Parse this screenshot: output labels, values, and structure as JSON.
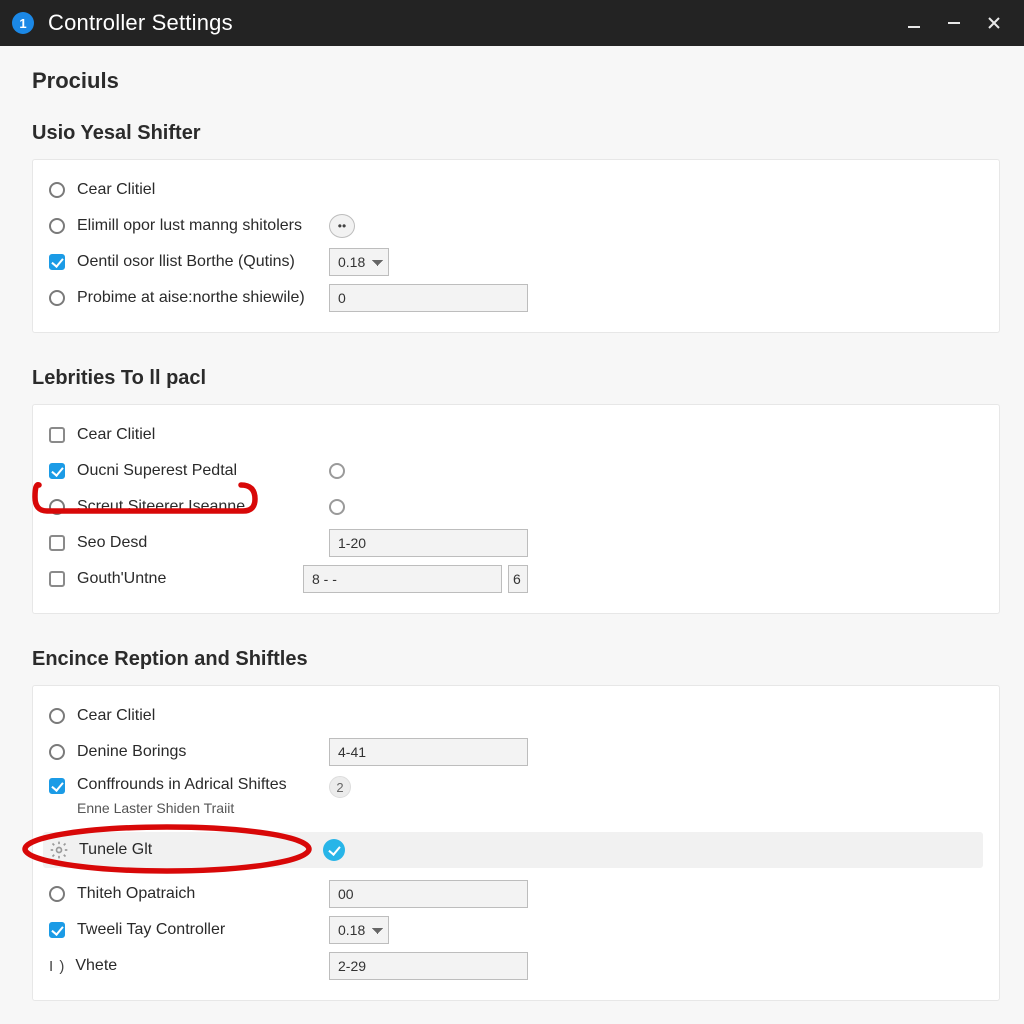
{
  "titlebar": {
    "badge": "1",
    "title": "Controller Settings"
  },
  "page_heading": "Prociuls",
  "sections": {
    "s1": {
      "heading": "Usio Yesal Shifter",
      "r0_label": "Cear Clitiel",
      "r1_label": "Elimill opor lust manng shitolers",
      "r2_label": "Oentil osor llist Borthe (Qutins)",
      "r2_value": "0.18",
      "r3_label": "Probime at aise:northe shiewile)",
      "r3_value": "0"
    },
    "s2": {
      "heading": "Lebrities To ll pacl",
      "r0_label": "Cear Clitiel",
      "r1_label": "Oucni Superest Pedtal",
      "r2_label": "Screut Siteerer Iseanne",
      "r3_label": "Seo Desd",
      "r3_value": "1-20",
      "r4_label": "Gouth'Untne",
      "r4_value_a": "8 - -",
      "r4_value_b": "6"
    },
    "s3": {
      "heading": "Encince Reption and Shiftles",
      "r0_label": "Cear Clitiel",
      "r1_label": "Denine Borings",
      "r1_value": "4-41",
      "r2_label": "Conffrounds in Adrical Shiftes",
      "r2_badge": "2",
      "r2_sub": "Enne Laster Shiden Traiit",
      "r3_label": "Tunele Glt",
      "r4_label": "Thiteh Opatraich",
      "r4_value": "00",
      "r5_label": "Tweeli Tay Controller",
      "r5_value": "0.18",
      "r6_left": "I )",
      "r6_label": "Vhete",
      "r6_value": "2-29"
    }
  }
}
